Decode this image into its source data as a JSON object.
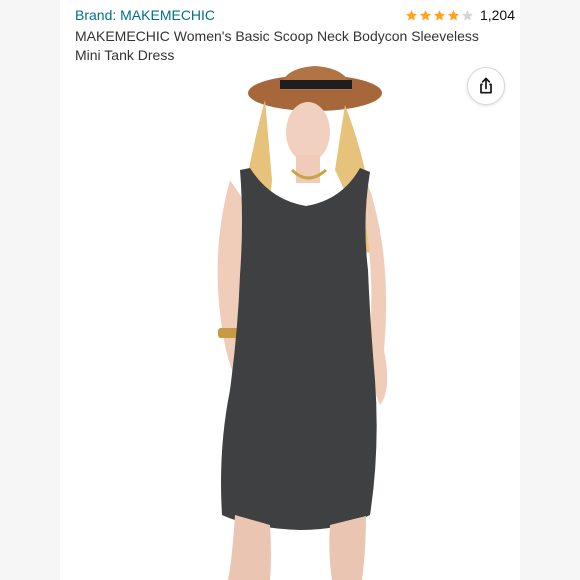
{
  "product": {
    "brand_label": "Brand: MAKEMECHIC",
    "rating_value": 4.0,
    "rating_count": "1,204",
    "title": "MAKEMECHIC Women's Basic Scoop Neck Bodycon Sleeveless Mini Tank Dress"
  },
  "icons": {
    "share": "share-icon",
    "star_full": "star-full-icon",
    "star_empty": "star-empty-icon"
  },
  "colors": {
    "brand_link": "#007185",
    "star": "#FFA41C",
    "star_empty": "#d5d5d5",
    "dress": "#3f4041"
  }
}
